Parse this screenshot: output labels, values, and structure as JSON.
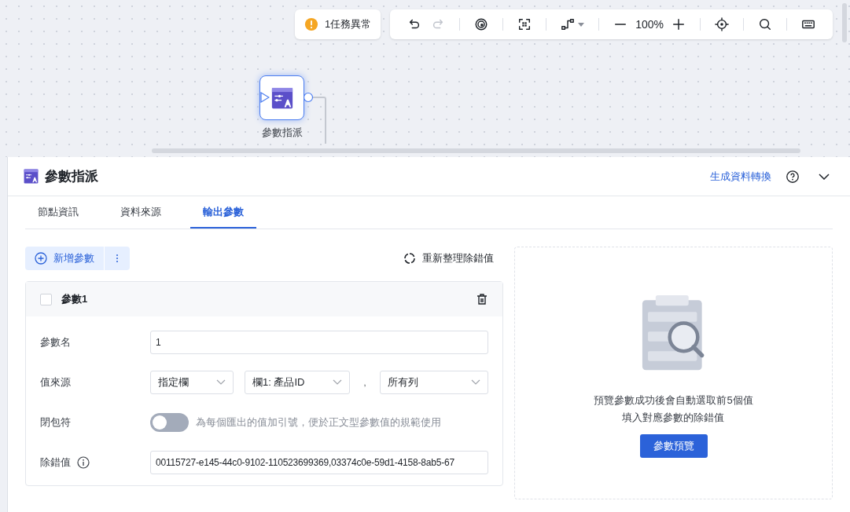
{
  "canvas": {
    "alert": "1任務異常",
    "tools": [
      {
        "kind": "undo",
        "disabled": false
      },
      {
        "kind": "redo",
        "disabled": true
      },
      {
        "kind": "sep"
      },
      {
        "kind": "eye"
      },
      {
        "kind": "sep"
      },
      {
        "kind": "fit"
      },
      {
        "kind": "sep"
      },
      {
        "kind": "route"
      },
      {
        "kind": "sep"
      },
      {
        "kind": "minus"
      },
      {
        "kind": "zoom",
        "text": "100%"
      },
      {
        "kind": "plus"
      },
      {
        "kind": "sep"
      },
      {
        "kind": "target"
      },
      {
        "kind": "sep"
      },
      {
        "kind": "search"
      },
      {
        "kind": "sep"
      },
      {
        "kind": "keyboard"
      }
    ],
    "node": {
      "label": "參數指派",
      "selected": true
    }
  },
  "panel": {
    "title": "參數指派",
    "link": "生成資料轉換",
    "tabs": [
      {
        "label": "節點資訊",
        "selected": false
      },
      {
        "label": "資料來源",
        "selected": false
      },
      {
        "label": "輸出參數",
        "selected": true
      }
    ],
    "add_button": "新增參數",
    "refresh": "重新整理除錯值",
    "param": {
      "title": "參數1",
      "checked": false,
      "fields": [
        {
          "kind": "text",
          "label": "參數名",
          "value": "1"
        },
        {
          "kind": "selects",
          "label": "值來源",
          "selects": [
            "指定欄",
            "欄1: 產品ID",
            "所有列"
          ],
          "separator": ","
        },
        {
          "kind": "toggle",
          "label": "閉包符",
          "on": false,
          "hint": "為每個匯出的值加引號，便於正文型參數值的規範使用"
        },
        {
          "kind": "debug",
          "label": "除錯值",
          "value": "00115727-e145-44c0-9102-110523699369,03374c0e-59d1-4158-8ab5-67"
        }
      ]
    },
    "preview": {
      "message": [
        "預覽參數成功後會自動選取前5個值",
        "填入對應參數的除錯值"
      ],
      "button": "參數預覽"
    }
  }
}
